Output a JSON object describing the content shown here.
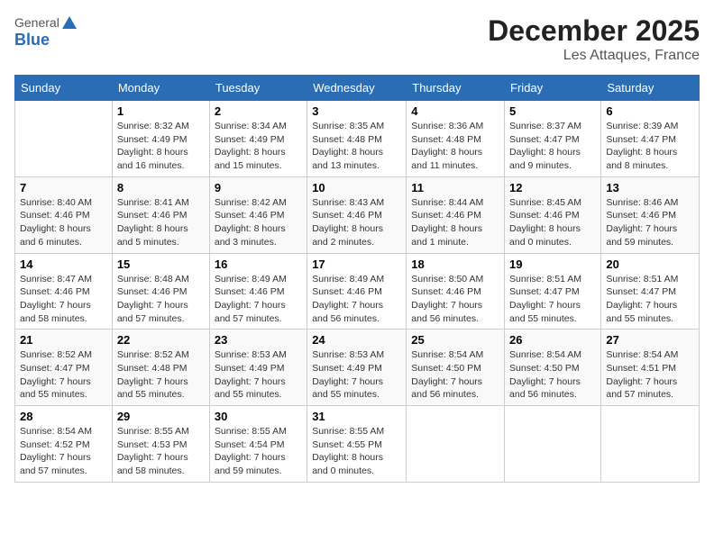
{
  "logo": {
    "general": "General",
    "blue": "Blue"
  },
  "title": "December 2025",
  "location": "Les Attaques, France",
  "days_header": [
    "Sunday",
    "Monday",
    "Tuesday",
    "Wednesday",
    "Thursday",
    "Friday",
    "Saturday"
  ],
  "weeks": [
    [
      {
        "day": "",
        "sunrise": "",
        "sunset": "",
        "daylight": ""
      },
      {
        "day": "1",
        "sunrise": "Sunrise: 8:32 AM",
        "sunset": "Sunset: 4:49 PM",
        "daylight": "Daylight: 8 hours and 16 minutes."
      },
      {
        "day": "2",
        "sunrise": "Sunrise: 8:34 AM",
        "sunset": "Sunset: 4:49 PM",
        "daylight": "Daylight: 8 hours and 15 minutes."
      },
      {
        "day": "3",
        "sunrise": "Sunrise: 8:35 AM",
        "sunset": "Sunset: 4:48 PM",
        "daylight": "Daylight: 8 hours and 13 minutes."
      },
      {
        "day": "4",
        "sunrise": "Sunrise: 8:36 AM",
        "sunset": "Sunset: 4:48 PM",
        "daylight": "Daylight: 8 hours and 11 minutes."
      },
      {
        "day": "5",
        "sunrise": "Sunrise: 8:37 AM",
        "sunset": "Sunset: 4:47 PM",
        "daylight": "Daylight: 8 hours and 9 minutes."
      },
      {
        "day": "6",
        "sunrise": "Sunrise: 8:39 AM",
        "sunset": "Sunset: 4:47 PM",
        "daylight": "Daylight: 8 hours and 8 minutes."
      }
    ],
    [
      {
        "day": "7",
        "sunrise": "Sunrise: 8:40 AM",
        "sunset": "Sunset: 4:46 PM",
        "daylight": "Daylight: 8 hours and 6 minutes."
      },
      {
        "day": "8",
        "sunrise": "Sunrise: 8:41 AM",
        "sunset": "Sunset: 4:46 PM",
        "daylight": "Daylight: 8 hours and 5 minutes."
      },
      {
        "day": "9",
        "sunrise": "Sunrise: 8:42 AM",
        "sunset": "Sunset: 4:46 PM",
        "daylight": "Daylight: 8 hours and 3 minutes."
      },
      {
        "day": "10",
        "sunrise": "Sunrise: 8:43 AM",
        "sunset": "Sunset: 4:46 PM",
        "daylight": "Daylight: 8 hours and 2 minutes."
      },
      {
        "day": "11",
        "sunrise": "Sunrise: 8:44 AM",
        "sunset": "Sunset: 4:46 PM",
        "daylight": "Daylight: 8 hours and 1 minute."
      },
      {
        "day": "12",
        "sunrise": "Sunrise: 8:45 AM",
        "sunset": "Sunset: 4:46 PM",
        "daylight": "Daylight: 8 hours and 0 minutes."
      },
      {
        "day": "13",
        "sunrise": "Sunrise: 8:46 AM",
        "sunset": "Sunset: 4:46 PM",
        "daylight": "Daylight: 7 hours and 59 minutes."
      }
    ],
    [
      {
        "day": "14",
        "sunrise": "Sunrise: 8:47 AM",
        "sunset": "Sunset: 4:46 PM",
        "daylight": "Daylight: 7 hours and 58 minutes."
      },
      {
        "day": "15",
        "sunrise": "Sunrise: 8:48 AM",
        "sunset": "Sunset: 4:46 PM",
        "daylight": "Daylight: 7 hours and 57 minutes."
      },
      {
        "day": "16",
        "sunrise": "Sunrise: 8:49 AM",
        "sunset": "Sunset: 4:46 PM",
        "daylight": "Daylight: 7 hours and 57 minutes."
      },
      {
        "day": "17",
        "sunrise": "Sunrise: 8:49 AM",
        "sunset": "Sunset: 4:46 PM",
        "daylight": "Daylight: 7 hours and 56 minutes."
      },
      {
        "day": "18",
        "sunrise": "Sunrise: 8:50 AM",
        "sunset": "Sunset: 4:46 PM",
        "daylight": "Daylight: 7 hours and 56 minutes."
      },
      {
        "day": "19",
        "sunrise": "Sunrise: 8:51 AM",
        "sunset": "Sunset: 4:47 PM",
        "daylight": "Daylight: 7 hours and 55 minutes."
      },
      {
        "day": "20",
        "sunrise": "Sunrise: 8:51 AM",
        "sunset": "Sunset: 4:47 PM",
        "daylight": "Daylight: 7 hours and 55 minutes."
      }
    ],
    [
      {
        "day": "21",
        "sunrise": "Sunrise: 8:52 AM",
        "sunset": "Sunset: 4:47 PM",
        "daylight": "Daylight: 7 hours and 55 minutes."
      },
      {
        "day": "22",
        "sunrise": "Sunrise: 8:52 AM",
        "sunset": "Sunset: 4:48 PM",
        "daylight": "Daylight: 7 hours and 55 minutes."
      },
      {
        "day": "23",
        "sunrise": "Sunrise: 8:53 AM",
        "sunset": "Sunset: 4:49 PM",
        "daylight": "Daylight: 7 hours and 55 minutes."
      },
      {
        "day": "24",
        "sunrise": "Sunrise: 8:53 AM",
        "sunset": "Sunset: 4:49 PM",
        "daylight": "Daylight: 7 hours and 55 minutes."
      },
      {
        "day": "25",
        "sunrise": "Sunrise: 8:54 AM",
        "sunset": "Sunset: 4:50 PM",
        "daylight": "Daylight: 7 hours and 56 minutes."
      },
      {
        "day": "26",
        "sunrise": "Sunrise: 8:54 AM",
        "sunset": "Sunset: 4:50 PM",
        "daylight": "Daylight: 7 hours and 56 minutes."
      },
      {
        "day": "27",
        "sunrise": "Sunrise: 8:54 AM",
        "sunset": "Sunset: 4:51 PM",
        "daylight": "Daylight: 7 hours and 57 minutes."
      }
    ],
    [
      {
        "day": "28",
        "sunrise": "Sunrise: 8:54 AM",
        "sunset": "Sunset: 4:52 PM",
        "daylight": "Daylight: 7 hours and 57 minutes."
      },
      {
        "day": "29",
        "sunrise": "Sunrise: 8:55 AM",
        "sunset": "Sunset: 4:53 PM",
        "daylight": "Daylight: 7 hours and 58 minutes."
      },
      {
        "day": "30",
        "sunrise": "Sunrise: 8:55 AM",
        "sunset": "Sunset: 4:54 PM",
        "daylight": "Daylight: 7 hours and 59 minutes."
      },
      {
        "day": "31",
        "sunrise": "Sunrise: 8:55 AM",
        "sunset": "Sunset: 4:55 PM",
        "daylight": "Daylight: 8 hours and 0 minutes."
      },
      {
        "day": "",
        "sunrise": "",
        "sunset": "",
        "daylight": ""
      },
      {
        "day": "",
        "sunrise": "",
        "sunset": "",
        "daylight": ""
      },
      {
        "day": "",
        "sunrise": "",
        "sunset": "",
        "daylight": ""
      }
    ]
  ]
}
